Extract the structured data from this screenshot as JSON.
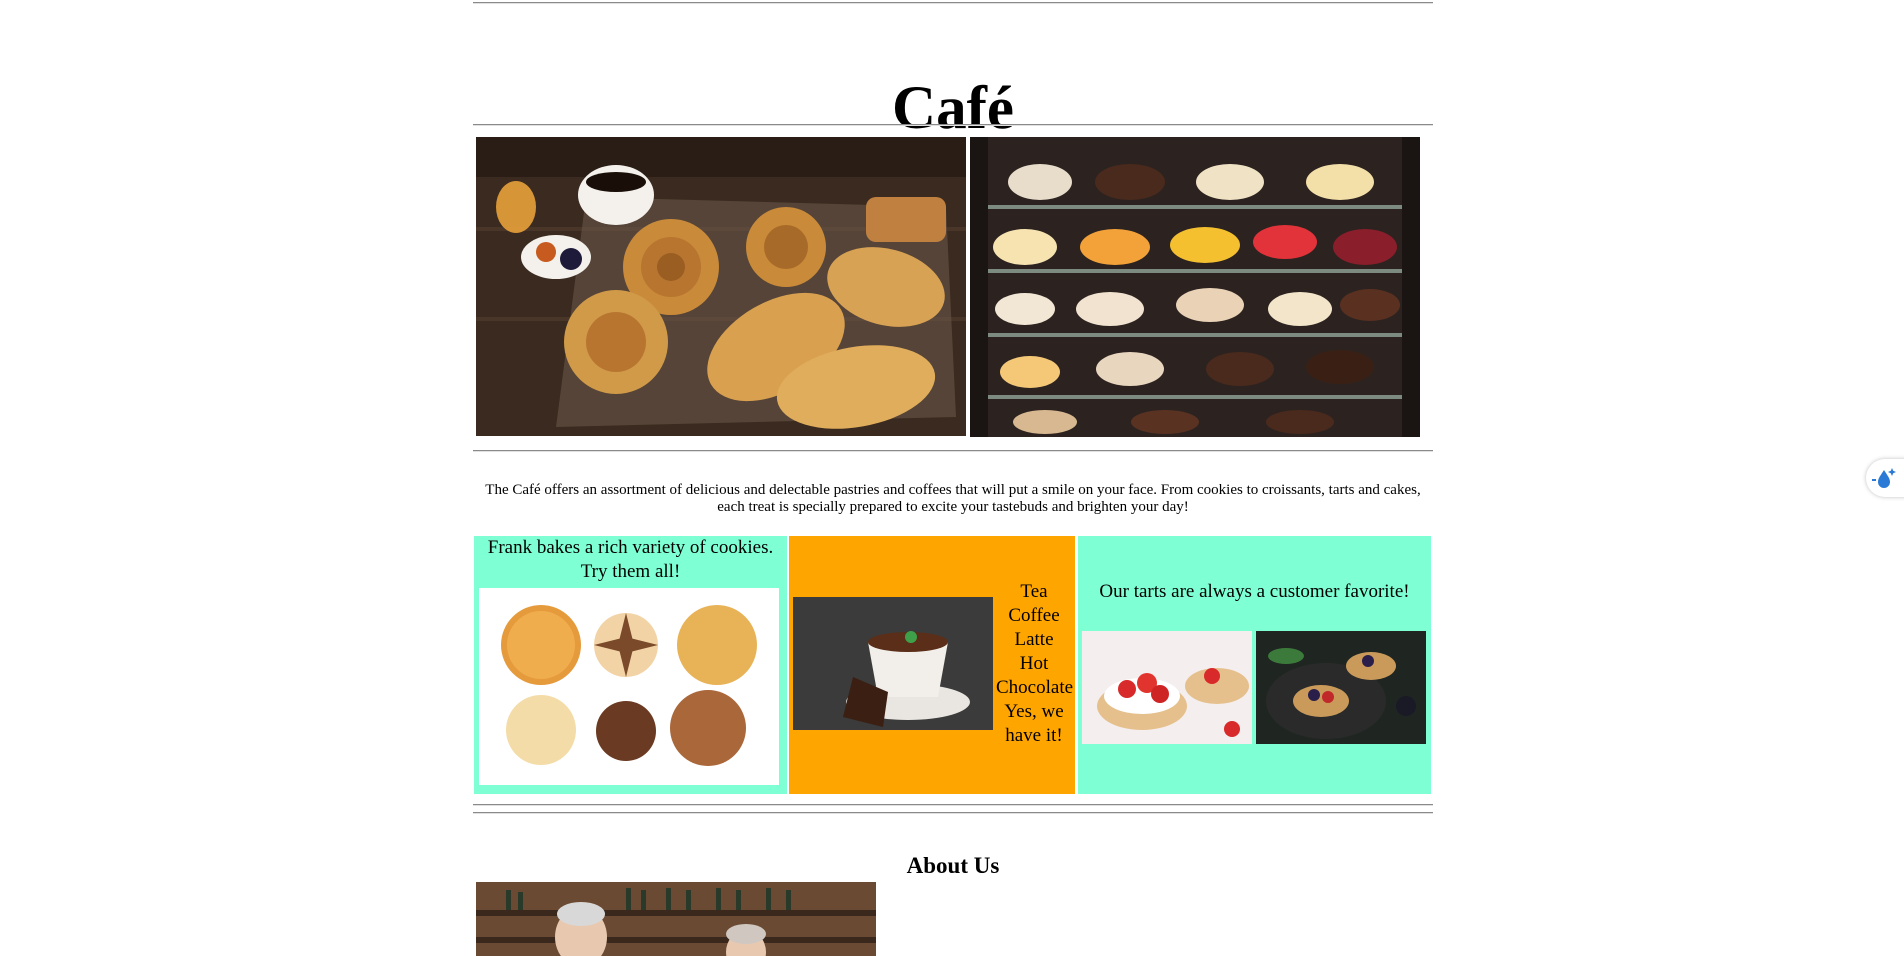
{
  "header": {
    "title": "Café"
  },
  "hero": {
    "images": [
      {
        "alt": "Pastries and coffee on a cooling rack",
        "icon": "pastries-photo"
      },
      {
        "alt": "Display case full of cakes",
        "icon": "cakes-photo"
      }
    ]
  },
  "intro": {
    "text": "The Café offers an assortment of delicious and delectable pastries and coffees that will put a smile on your face. From cookies to croissants, tarts and cakes, each treat is specially prepared to excite your tastebuds and brighten your day!"
  },
  "features": {
    "cookies": {
      "caption": "Frank bakes a rich variety of cookies. Try them all!",
      "background": "#7fffd4"
    },
    "drinks": {
      "items": [
        "Tea",
        "Coffee",
        "Latte",
        "Hot",
        "Chocolate",
        "Yes, we",
        "have it!"
      ],
      "background": "#ffa500"
    },
    "tarts": {
      "caption": "Our tarts are always a customer favorite!",
      "background": "#7fffd4"
    }
  },
  "about": {
    "title": "About Us"
  },
  "widget": {
    "icon": "water-drop-sparkle-icon",
    "accent": "#2b7bd6"
  }
}
